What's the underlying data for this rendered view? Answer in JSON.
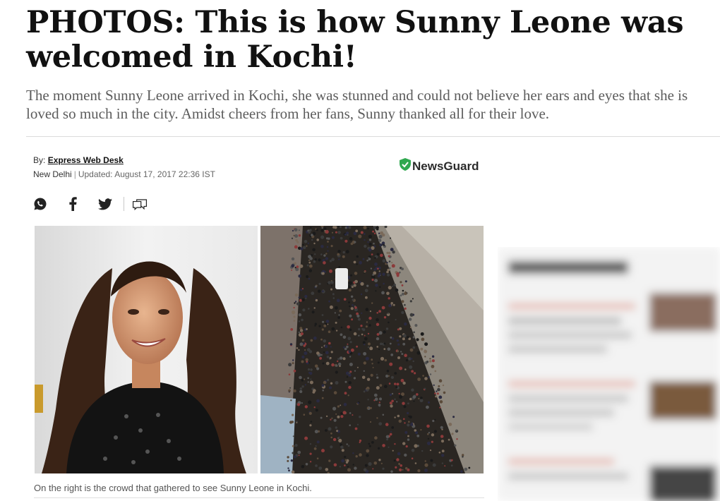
{
  "article": {
    "headline": "PHOTOS: This is how Sunny Leone was welcomed in Kochi!",
    "standfirst": "The moment Sunny Leone arrived in Kochi, she was stunned and could not believe her ears and eyes that she is loved so much in the city. Amidst cheers from her fans, Sunny thanked all for their love.",
    "byline": {
      "by_label": "By:",
      "author": "Express Web Desk",
      "location": "New Delhi",
      "separator": "|",
      "updated": "Updated: August 17, 2017 22:36 IST"
    },
    "newsguard_label": "NewsGuard",
    "social_icons": [
      "whatsapp-icon",
      "facebook-icon",
      "twitter-icon",
      "comments-icon"
    ],
    "image_caption": "On the right is the crowd that gathered to see Sunny Leone in Kochi."
  },
  "colors": {
    "headline": "#111111",
    "standfirst": "#5c5c5c",
    "newsguard_shield": "#2fa84f"
  }
}
